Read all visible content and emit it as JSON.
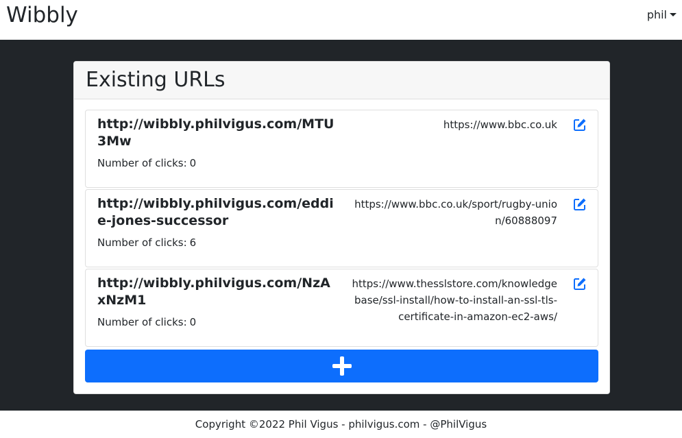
{
  "navbar": {
    "brand": "Wibbly",
    "user": "phil"
  },
  "card": {
    "title": "Existing URLs"
  },
  "urls": [
    {
      "short_url": "http://wibbly.philvigus.com/MTU3Mw",
      "clicks_label": "Number of clicks:",
      "clicks": "0",
      "destination": "https://www.bbc.co.uk"
    },
    {
      "short_url": "http://wibbly.philvigus.com/eddie-jones-successor",
      "clicks_label": "Number of clicks:",
      "clicks": "6",
      "destination": "https://www.bbc.co.uk/sport/rugby-union/60888097"
    },
    {
      "short_url": "http://wibbly.philvigus.com/NzAxNzM1",
      "clicks_label": "Number of clicks:",
      "clicks": "0",
      "destination": "https://www.thesslstore.com/knowledgebase/ssl-install/how-to-install-an-ssl-tls-certificate-in-amazon-ec2-aws/"
    }
  ],
  "add_button": {
    "icon": "plus-icon"
  },
  "footer": {
    "text": "Copyright ©2022 Phil Vigus - philvigus.com - @PhilVigus"
  },
  "colors": {
    "primary": "#0d6efd",
    "dark_background": "#212529",
    "edit_icon": "#0d6efd"
  }
}
